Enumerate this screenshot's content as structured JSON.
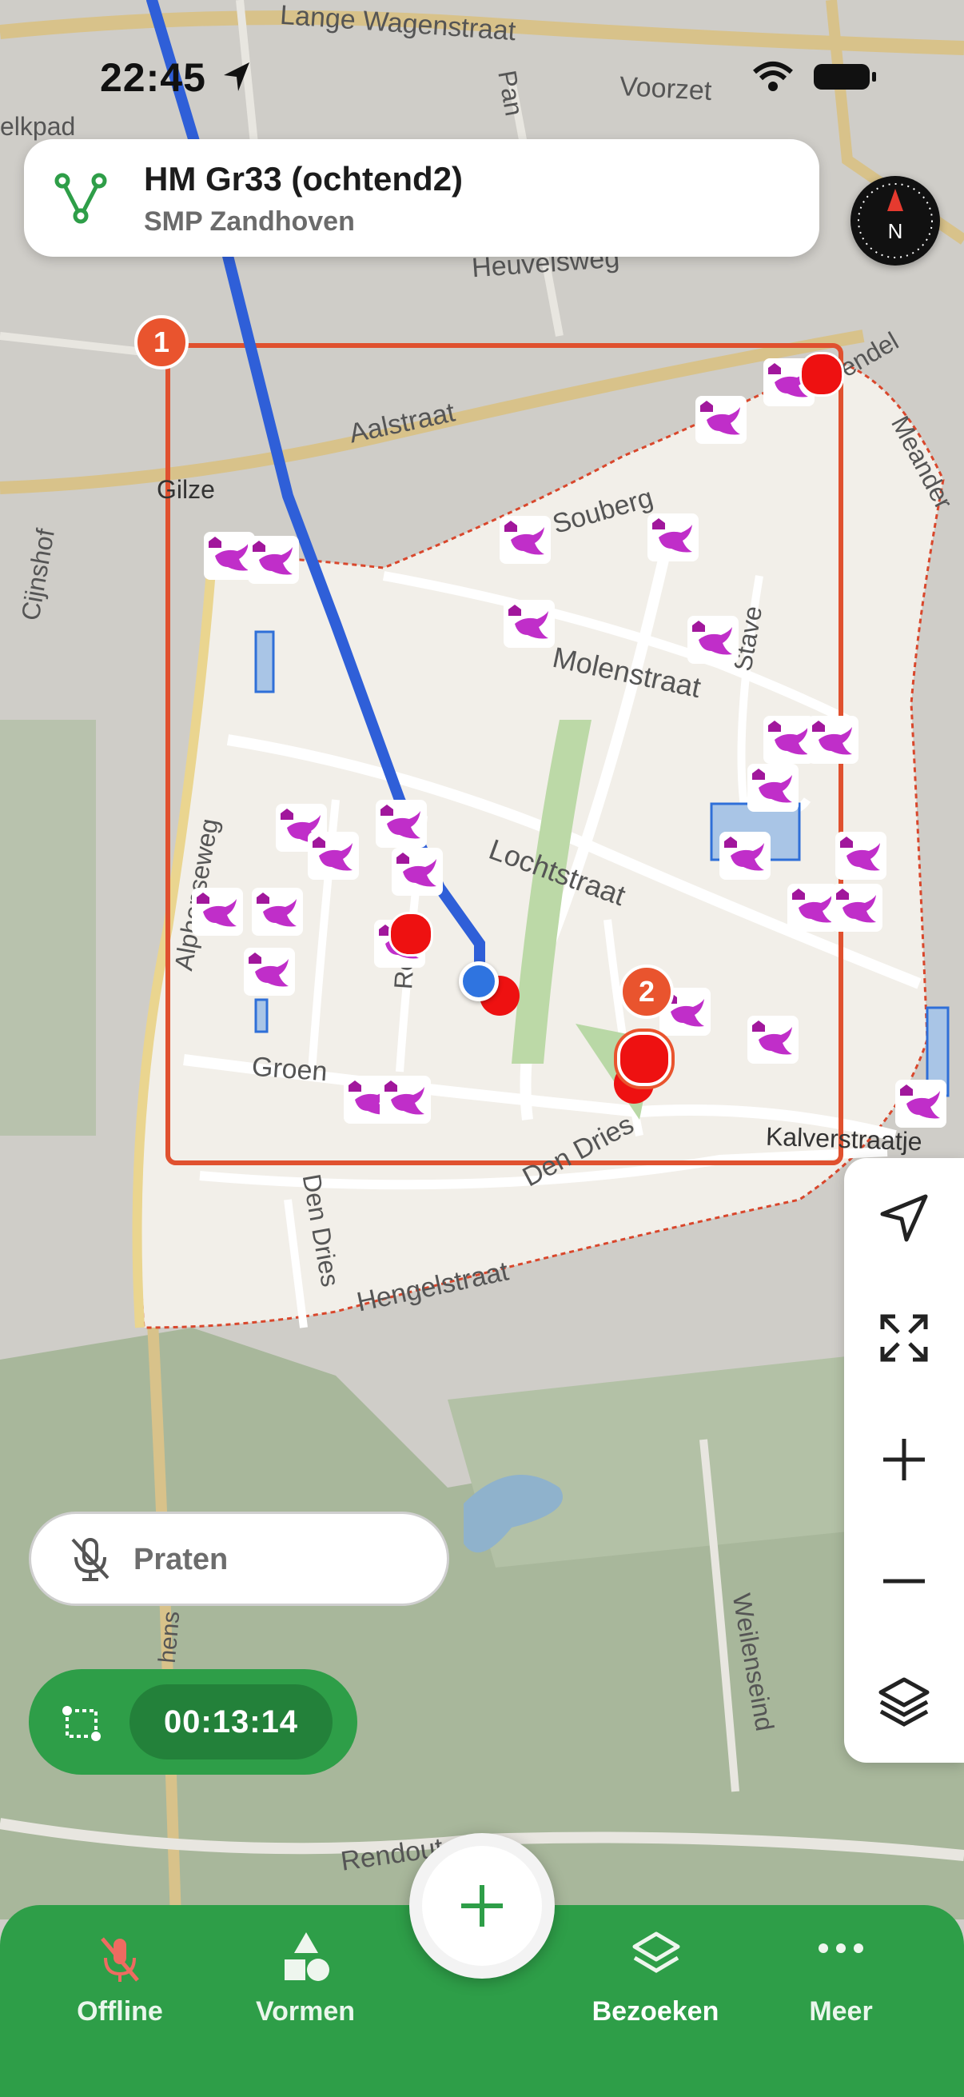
{
  "status_bar": {
    "time": "22:45"
  },
  "route_card": {
    "title": "HM Gr33 (ochtend2)",
    "subtitle": "SMP Zandhoven"
  },
  "compass": {
    "letter": "N"
  },
  "map": {
    "street_labels": [
      "Lange Wagenstraat",
      "Voorzet",
      "Pan",
      "elkpad",
      "Heuvelsweg",
      "Aalstraat",
      "Gilze",
      "Cijnshof",
      "Souberg",
      "Molenstraat",
      "Lochtstraat",
      "Meander",
      "Vendel",
      "Stave",
      "Alphenseweg",
      "Groen",
      "Reit",
      "Den Dries",
      "Hengelstraat",
      "Kalverstraatje",
      "Hengelstraat",
      "Weilenseind",
      "Rendout",
      "Den Dries",
      "hens"
    ],
    "markers": [
      {
        "label": "1"
      },
      {
        "label": "2"
      }
    ]
  },
  "map_controls": {
    "locate": "location-arrow-icon",
    "fit": "expand-icon",
    "zoom_in": "plus-icon",
    "zoom_out": "minus-icon",
    "layers": "layers-icon"
  },
  "talk_button": {
    "label": "Praten"
  },
  "timer": {
    "value": "00:13:14"
  },
  "tabbar": {
    "tabs": [
      {
        "label": "Offline"
      },
      {
        "label": "Vormen"
      },
      {
        "label": "Bezoeken"
      },
      {
        "label": "Meer"
      }
    ]
  },
  "colors": {
    "accent_green": "#2e9e48",
    "dark_green": "#23813a",
    "marker_orange": "#e9542e",
    "route_blue": "#2f5fd8",
    "poi_magenta": "#c02ec9",
    "marker_red": "#ee1111"
  }
}
